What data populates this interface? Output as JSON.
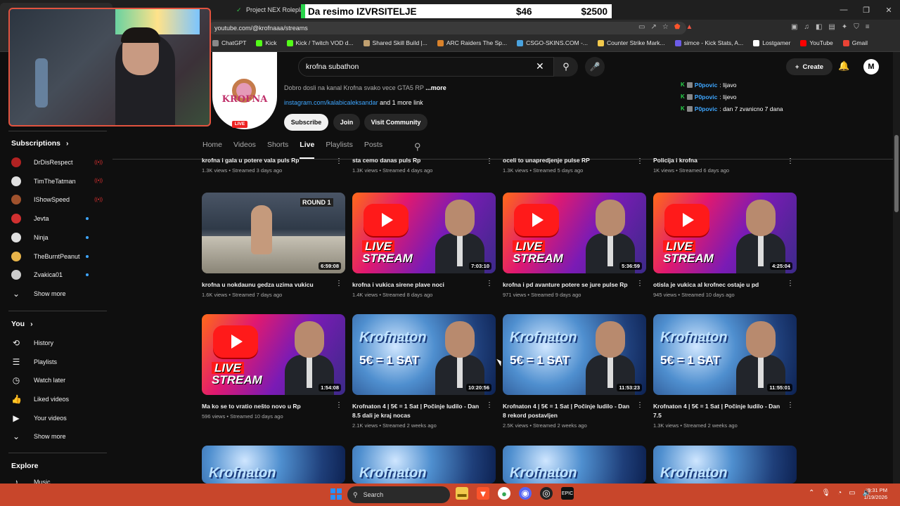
{
  "browser": {
    "tab2_title": "Project NEX Roleplay",
    "url": "youtube.com/@krofnaaa/streams",
    "bookmarks": [
      {
        "label": "ChatGPT",
        "color": "#888888"
      },
      {
        "label": "Kick",
        "color": "#53fc18"
      },
      {
        "label": "Kick / Twitch VOD d...",
        "color": "#53fc18"
      },
      {
        "label": "Shared Skill Build |...",
        "color": "#c0a070"
      },
      {
        "label": "ARC Raiders The Sp...",
        "color": "#d9822b"
      },
      {
        "label": "CSGO-SKINS.COM -...",
        "color": "#4aa3df"
      },
      {
        "label": "Counter Strike Mark...",
        "color": "#f2c94c"
      },
      {
        "label": "simce - Kick Stats, A...",
        "color": "#6c5ce7"
      },
      {
        "label": "Lostgamer",
        "color": "#ffffff"
      },
      {
        "label": "YouTube",
        "color": "#ff0000"
      },
      {
        "label": "Gmail",
        "color": "#ea4335"
      }
    ]
  },
  "overlay": {
    "title": "Da resimo IZVRSITELJE",
    "price1": "$46",
    "price2": "$2500"
  },
  "header": {
    "search_value": "krofna subathon",
    "create_label": "Create",
    "account_initial": "M"
  },
  "channel": {
    "logo_text": "KROFNA",
    "live_badge": "LIVE",
    "description": "Dobro dosli na kanal Krofna svako vece GTA5 RP",
    "more": "...more",
    "link": "instagram.com/kalabicaleksandar",
    "more_links": "and 1 more link",
    "subscribe": "Subscribe",
    "join": "Join",
    "visit": "Visit Community"
  },
  "chat": [
    {
      "user": "P0povic",
      "msg": ": lijavo"
    },
    {
      "user": "P0povic",
      "msg": ": lijevo"
    },
    {
      "user": "P0povic",
      "msg": ": dan 7 zvanicno 7 dana"
    }
  ],
  "tabs": [
    "Home",
    "Videos",
    "Shorts",
    "Live",
    "Playlists",
    "Posts"
  ],
  "active_tab": "Live",
  "sidebar": {
    "subscriptions_title": "Subscriptions",
    "subscriptions": [
      {
        "name": "DrDisRespect",
        "status": "live",
        "color": "#b22222"
      },
      {
        "name": "TimTheTatman",
        "status": "live",
        "color": "#e0e0e0"
      },
      {
        "name": "IShowSpeed",
        "status": "live",
        "color": "#a0522d"
      },
      {
        "name": "Jevta",
        "status": "new",
        "color": "#d03030"
      },
      {
        "name": "Ninja",
        "status": "new",
        "color": "#e0e0e0"
      },
      {
        "name": "TheBurntPeanut",
        "status": "new",
        "color": "#e8b44a"
      },
      {
        "name": "Zvakica01",
        "status": "new",
        "color": "#cccccc"
      }
    ],
    "show_more": "Show more",
    "you_title": "You",
    "you_items": [
      {
        "label": "History",
        "icon": "history-icon",
        "glyph": "⟲"
      },
      {
        "label": "Playlists",
        "icon": "playlists-icon",
        "glyph": "☰"
      },
      {
        "label": "Watch later",
        "icon": "clock-icon",
        "glyph": "◷"
      },
      {
        "label": "Liked videos",
        "icon": "thumbs-up-icon",
        "glyph": "👍"
      },
      {
        "label": "Your videos",
        "icon": "your-videos-icon",
        "glyph": "▶"
      }
    ],
    "show_more_2": "Show more",
    "explore_title": "Explore",
    "explore_items": [
      {
        "label": "Music",
        "icon": "music-icon",
        "glyph": "♪"
      }
    ]
  },
  "videos_row0": [
    {
      "title": "krofna i gala u potere vala puls Rp",
      "meta": "1.3K views • Streamed 3 days ago"
    },
    {
      "title": "sta cemo danas puls Rp",
      "meta": "1.3K views • Streamed 4 days ago"
    },
    {
      "title": "oceli to unapredjenje pulse RP",
      "meta": "1.3K views • Streamed 5 days ago"
    },
    {
      "title": "Policija i krofna",
      "meta": "1K views • Streamed 6 days ago"
    }
  ],
  "videos": [
    {
      "title": "krofna u nokdaunu gedza uzima vukicu",
      "meta": "1.6K views • Streamed 7 days ago",
      "duration": "6:59:08",
      "thumb": "fight",
      "round": "ROUND 1"
    },
    {
      "title": "krofna i vukica sirene plave noci",
      "meta": "1.4K views • Streamed 8 days ago",
      "duration": "7:03:10",
      "thumb": "live"
    },
    {
      "title": "krofna i pd avanture potere se jure pulse Rp",
      "meta": "971 views • Streamed 9 days ago",
      "duration": "5:36:59",
      "thumb": "live"
    },
    {
      "title": "otisla je vukica al krofnec ostaje u pd",
      "meta": "945 views • Streamed 10 days ago",
      "duration": "4:25:04",
      "thumb": "live"
    },
    {
      "title": "Ma ko se to vratio nešto novo u Rp",
      "meta": "596 views • Streamed 10 days ago",
      "duration": "1:54:08",
      "thumb": "live"
    },
    {
      "title": "Krofnaton 4 | 5€ = 1 Sat | Počinje ludilo - Dan 8.5 dali je kraj nocas",
      "meta": "2.1K views • Streamed 2 weeks ago",
      "duration": "10:20:56",
      "thumb": "kroff"
    },
    {
      "title": "Krofnaton 4 | 5€ = 1 Sat | Počinje ludilo - Dan 8 rekord postavljen",
      "meta": "2.5K views • Streamed 2 weeks ago",
      "duration": "11:53:23",
      "thumb": "kroff"
    },
    {
      "title": "Krofnaton 4 | 5€ = 1 Sat | Počinje ludilo - Dan 7.5",
      "meta": "1.3K views • Streamed 2 weeks ago",
      "duration": "11:55:01",
      "thumb": "kroff"
    }
  ],
  "thumb_text": {
    "live": "LIVE",
    "stream": "STREAM",
    "krofnaton": "Krofnaton",
    "sat": "5€ = 1 SAT"
  },
  "taskbar": {
    "search": "Search",
    "time": "9:31 PM",
    "date": "1/19/2026"
  }
}
